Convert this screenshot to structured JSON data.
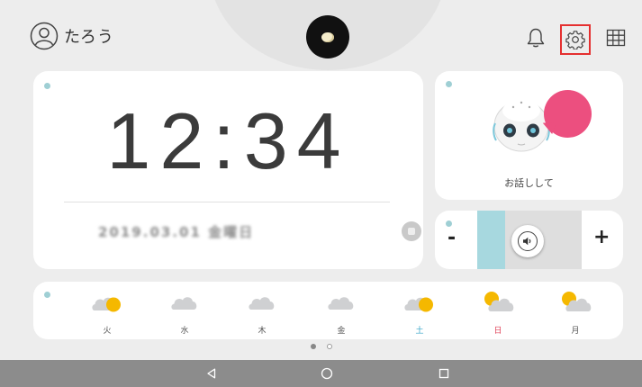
{
  "header": {
    "user_name": "たろう",
    "icons": [
      "user-icon",
      "robot-eye-icon",
      "bell-icon",
      "gear-icon",
      "grid-icon"
    ]
  },
  "clock": {
    "time": "12:34",
    "date_blurred": "2019.03.01 金曜日"
  },
  "talk": {
    "label": "お話しして"
  },
  "volume": {
    "minus": "-",
    "plus": "+",
    "level": 0.27
  },
  "weather": {
    "days": [
      {
        "label": "火",
        "icon": "partly-sunny-icon",
        "color": "#555555"
      },
      {
        "label": "水",
        "icon": "cloud-icon",
        "color": "#555555"
      },
      {
        "label": "木",
        "icon": "cloud-icon",
        "color": "#555555"
      },
      {
        "label": "金",
        "icon": "cloud-icon",
        "color": "#555555"
      },
      {
        "label": "土",
        "icon": "partly-sunny-icon",
        "color": "#3aa6c9"
      },
      {
        "label": "日",
        "icon": "sun-behind-cloud-icon",
        "color": "#e0445a"
      },
      {
        "label": "月",
        "icon": "sun-behind-cloud-icon",
        "color": "#555555"
      }
    ]
  },
  "pager": {
    "pages": 2,
    "current": 1
  },
  "colors": {
    "accent_dot": "#9fcfd4",
    "settings_highlight": "#e53030",
    "bubble": "#ec4f7f",
    "volume_fill": "#a7d8df",
    "sun": "#f5b800"
  }
}
